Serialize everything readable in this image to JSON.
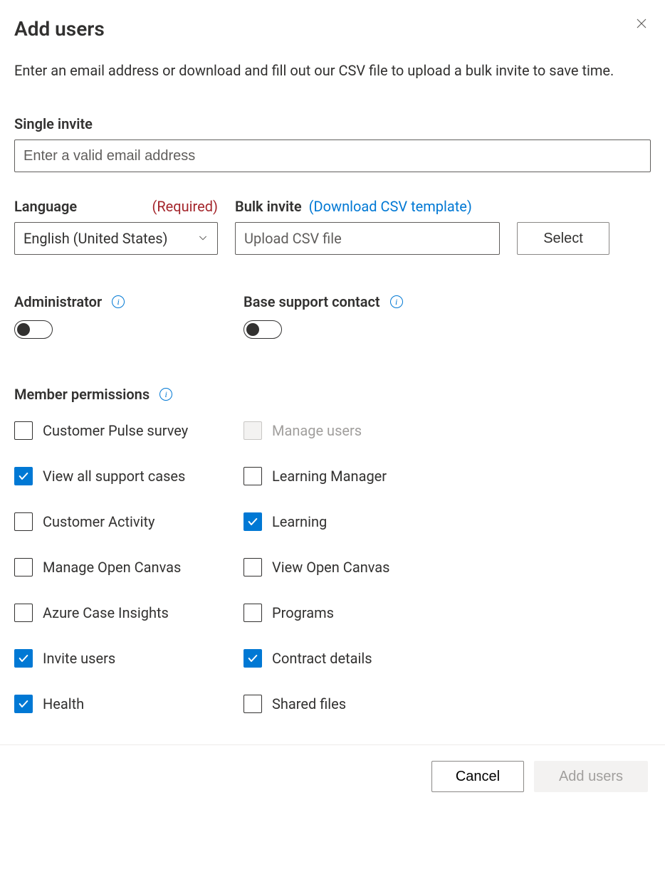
{
  "header": {
    "title": "Add users"
  },
  "intro": "Enter an email address or download and fill out our CSV file to upload a bulk invite to save time.",
  "single_invite": {
    "label": "Single invite",
    "placeholder": "Enter a valid email address"
  },
  "language": {
    "label": "Language",
    "required_text": "(Required)",
    "value": "English (United States)"
  },
  "bulk_invite": {
    "label": "Bulk invite",
    "download_link": "(Download CSV template)",
    "upload_placeholder": "Upload CSV file",
    "select_button": "Select"
  },
  "toggles": {
    "administrator": {
      "label": "Administrator",
      "on": false
    },
    "base_support_contact": {
      "label": "Base support contact",
      "on": false
    }
  },
  "permissions": {
    "title": "Member permissions",
    "left": [
      {
        "key": "customer-pulse-survey",
        "label": "Customer Pulse survey",
        "checked": false,
        "disabled": false
      },
      {
        "key": "view-all-support-cases",
        "label": "View all support cases",
        "checked": true,
        "disabled": false
      },
      {
        "key": "customer-activity",
        "label": "Customer Activity",
        "checked": false,
        "disabled": false
      },
      {
        "key": "manage-open-canvas",
        "label": "Manage Open Canvas",
        "checked": false,
        "disabled": false
      },
      {
        "key": "azure-case-insights",
        "label": "Azure Case Insights",
        "checked": false,
        "disabled": false
      },
      {
        "key": "invite-users",
        "label": "Invite users",
        "checked": true,
        "disabled": false
      },
      {
        "key": "health",
        "label": "Health",
        "checked": true,
        "disabled": false
      }
    ],
    "right": [
      {
        "key": "manage-users",
        "label": "Manage users",
        "checked": false,
        "disabled": true
      },
      {
        "key": "learning-manager",
        "label": "Learning Manager",
        "checked": false,
        "disabled": false
      },
      {
        "key": "learning",
        "label": "Learning",
        "checked": true,
        "disabled": false
      },
      {
        "key": "view-open-canvas",
        "label": "View Open Canvas",
        "checked": false,
        "disabled": false
      },
      {
        "key": "programs",
        "label": "Programs",
        "checked": false,
        "disabled": false
      },
      {
        "key": "contract-details",
        "label": "Contract details",
        "checked": true,
        "disabled": false
      },
      {
        "key": "shared-files",
        "label": "Shared files",
        "checked": false,
        "disabled": false
      }
    ]
  },
  "footer": {
    "cancel": "Cancel",
    "add_users": "Add users"
  }
}
